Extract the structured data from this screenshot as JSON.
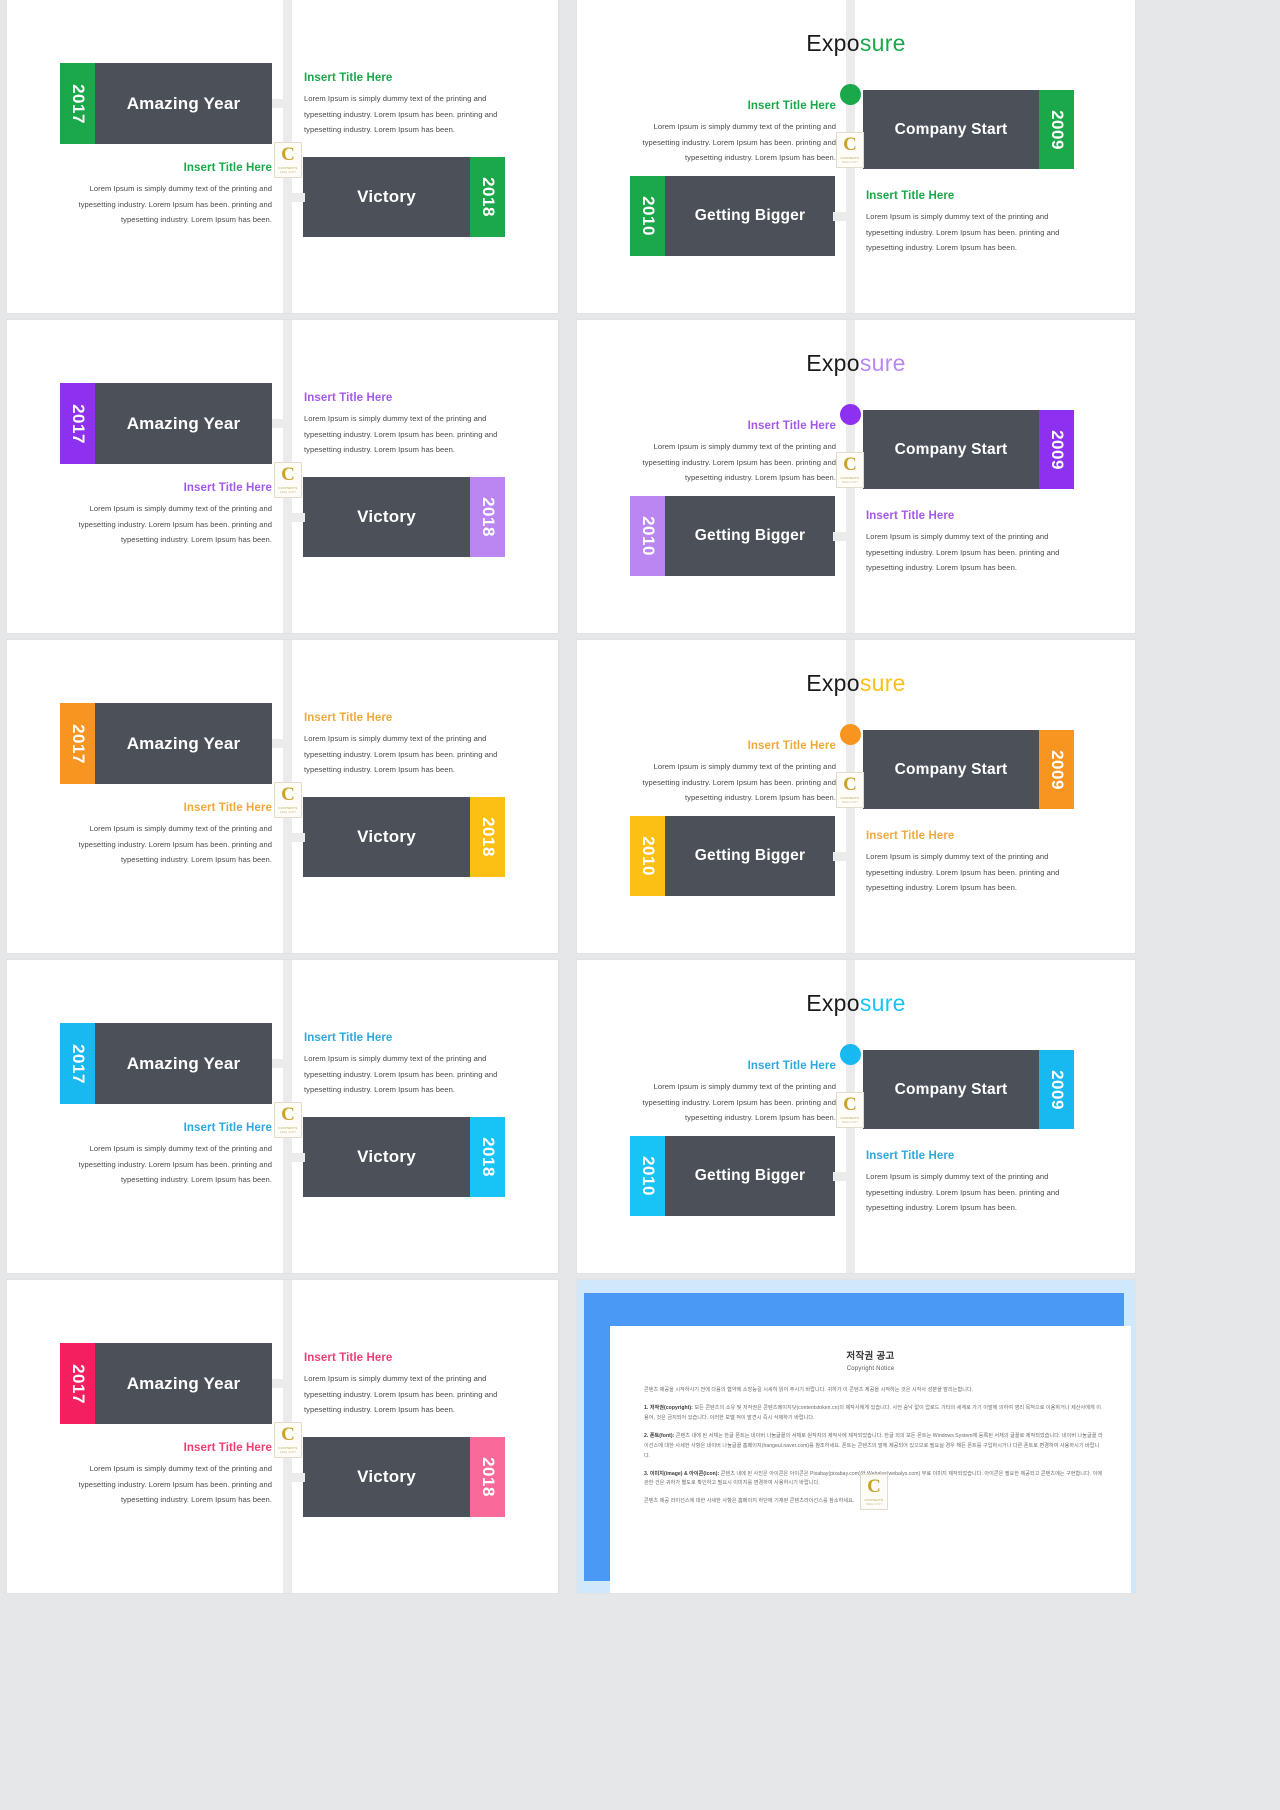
{
  "meta": {
    "bg": "#e6e7e8",
    "dark": "#4b5059",
    "rail": "#ebebeb"
  },
  "strings": {
    "insert_title": "Insert Title Here",
    "lorem": "Lorem Ipsum is simply dummy text of the printing and typesetting industry. Lorem Ipsum has been. printing and typesetting industry. Lorem Ipsum has been.",
    "amazing_year": "Amazing Year",
    "victory": "Victory",
    "company_start": "Company Start",
    "getting_bigger": "Getting Bigger",
    "year_2017": "2017",
    "year_2018": "2018",
    "year_2009": "2009",
    "year_2010": "2010",
    "expo_black": "Expo",
    "expo_color": "sure"
  },
  "logo": {
    "mark": "C",
    "line1": "CONTENTS",
    "line2": "FREE FONT"
  },
  "themes": [
    {
      "name": "green",
      "accent": "#1aa84a",
      "accent_soft": "#1aa84a",
      "title": "#1aa84a"
    },
    {
      "name": "purple",
      "accent": "#8e30f0",
      "accent_soft": "#bb86f2",
      "title": "#a35ae8"
    },
    {
      "name": "orange",
      "accent": "#f79520",
      "accent_soft": "#fcc015",
      "title": "#f0a93c"
    },
    {
      "name": "cyan",
      "accent": "#18b8f0",
      "accent_soft": "#18c4f5",
      "title": "#2ea8dd"
    },
    {
      "name": "pink",
      "accent": "#f41f5e",
      "accent_soft": "#f96a9a",
      "title": "#ef3e73"
    }
  ],
  "slides_left": [
    {
      "theme": 0,
      "year_a": "2017",
      "title_a": "Amazing Year",
      "year_b": "2018",
      "title_b": "Victory"
    },
    {
      "theme": 1,
      "year_a": "2017",
      "title_a": "Amazing Year",
      "year_b": "2018",
      "title_b": "Victory"
    },
    {
      "theme": 2,
      "year_a": "2017",
      "title_a": "Amazing Year",
      "year_b": "2018",
      "title_b": "Victory"
    },
    {
      "theme": 3,
      "year_a": "2017",
      "title_a": "Amazing Year",
      "year_b": "2018",
      "title_b": "Victory"
    },
    {
      "theme": 4,
      "year_a": "2017",
      "title_a": "Amazing Year",
      "year_b": "2018",
      "title_b": "Victory"
    }
  ],
  "slides_right": [
    {
      "theme": 0,
      "heading_black": "Expo",
      "heading_color": "sure",
      "year_a": "2009",
      "title_a": "Company Start",
      "year_b": "2010",
      "title_b": "Getting Bigger"
    },
    {
      "theme": 1,
      "heading_black": "Expo",
      "heading_color": "sure",
      "year_a": "2009",
      "title_a": "Company Start",
      "year_b": "2010",
      "title_b": "Getting Bigger"
    },
    {
      "theme": 2,
      "heading_black": "Expo",
      "heading_color": "sure",
      "year_a": "2009",
      "title_a": "Company Start",
      "year_b": "2010",
      "title_b": "Getting Bigger"
    },
    {
      "theme": 3,
      "heading_black": "Expo",
      "heading_color": "sure",
      "year_a": "2009",
      "title_a": "Company Start",
      "year_b": "2010",
      "title_b": "Getting Bigger"
    }
  ],
  "copyright": {
    "title": "저작권 공고",
    "subtitle": "Copyright Notice",
    "intro": "콘텐츠 제공을 시작하시기 전에 다음의 협약에 소장능길 시세히 읽어 주시기 바랍니다. 귀하가 이 콘텐츠 제공을 시작하는 것은 시작사 성분을 말리는합니다.",
    "p1_label": "1. 저작권(copyright):",
    "p1": "보든 콘텐츠의 소유 및 저작권은 콘텐츠메이지닷(contentstoken.cn)의 제작사에게 있습니다. 사전 승낙 없이 업로드 기타의 세계로 가기 이발에 의하여 영리 목적으로 이용하거나 제산사에게 이용어, 것은 금지되어 있습니다. 이러한 모델 적이 발견시 즉시 삭제하기 바랍니다.",
    "p2_label": "2. 폰트(font):",
    "p2": "콘텐츠 내에 된 서체는 한글 폰트는 네이버 나눔글꼴의 서체로 원작자의 제작사에 제작되었습니다. 한글 외의 보든 폰트는 Windows System에 등록된 서체의 글꼴로 제작되었습니다. 네이버 나눔글꼴 라이선스에 대한 사세한 사항은 네이버 나눔글꼴 홈페이지(hangeul.naver.com)를 참조하세요. 폰트는 콘텐츠의 말에 제공되어 있으므로 필요실 경우 해든 폰트를 구입하시거나 다른 폰트로 변경하여 사용하시기 바랍니다.",
    "p3_label": "3. 이미지(image) & 아이콘(icon):",
    "p3": "콘텐츠 내에 된 사진은 아이콘은 아이콘은 Pixabay(pixabay.com)와 Webalys(webalys.com) 무료 이미지 제작되었습니다. 아이콘은 필요한 제공되고 콘텐츠에는 구현합니다. 이에 관한 건은 귀하가 별도로 확인하고 필요시 이미지를 변경하여 사용하시기 바랍니다.",
    "footer": "콘텐츠 제공 라이선스에 대한 사세한 사항은 홈페이지 하단에 기재된 콘텐츠라이선스를 참소하세요."
  }
}
